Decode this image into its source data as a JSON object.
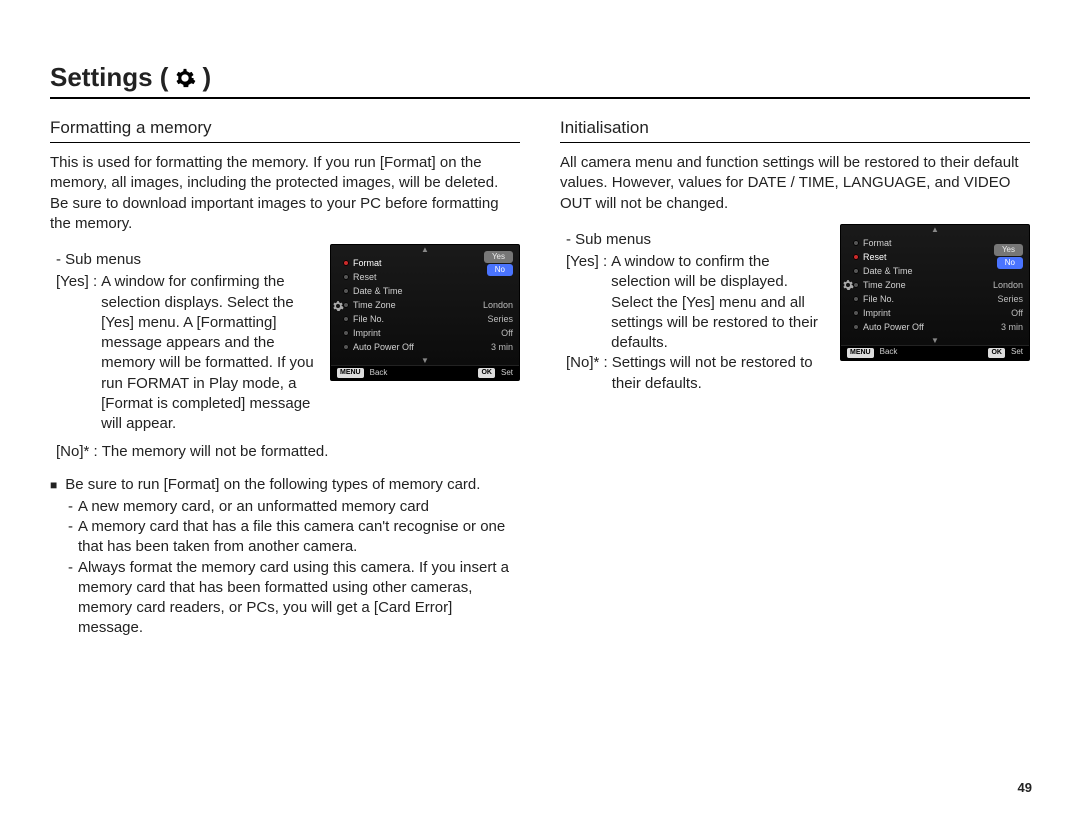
{
  "page": {
    "title_prefix": "Settings (",
    "title_suffix": ")",
    "number": "49"
  },
  "left": {
    "heading": "Formatting a memory",
    "intro": "This is used for formatting the memory. If you run [Format] on the memory, all images, including the protected images, will be deleted. Be sure to download important images to your PC before formatting the memory.",
    "sub_label": "- Sub menus",
    "yes_key": "[Yes] :",
    "yes_val": "A window for confirming the selection displays. Select the [Yes] menu. A [Formatting] message appears and the memory will be formatted. If you run FORMAT in Play mode, a [Format is completed] message will appear.",
    "no_key": "[No]* :",
    "no_val": "The memory will not be formatted.",
    "bullet_lead": "Be sure to run [Format] on the following types of memory card.",
    "dash": [
      "A new memory card, or an unformatted memory card",
      "A memory card that has a file this camera can't recognise or one that has been taken from another camera.",
      "Always format the memory card using this camera. If you insert a memory card that has been formatted using other cameras, memory card readers, or PCs, you will get a [Card Error] message."
    ]
  },
  "right": {
    "heading": "Initialisation",
    "intro": "All camera menu and function settings will be restored to their default values. However, values for DATE / TIME, LANGUAGE, and VIDEO OUT will not be changed.",
    "sub_label": "- Sub menus",
    "yes_key": "[Yes] :",
    "yes_val": "A window to confirm the selection will be displayed. Select the [Yes] menu and all settings will be restored to their defaults.",
    "no_key": "[No]* :",
    "no_val": "Settings will not be restored to their defaults."
  },
  "cam_common": {
    "items": [
      {
        "label": "Format"
      },
      {
        "label": "Reset"
      },
      {
        "label": "Date & Time"
      },
      {
        "label": "Time Zone",
        "value": "London"
      },
      {
        "label": "File No.",
        "value": "Series"
      },
      {
        "label": "Imprint",
        "value": "Off"
      },
      {
        "label": "Auto Power Off",
        "value": "3 min"
      }
    ],
    "opts_yes": "Yes",
    "opts_no": "No",
    "footer_back_tag": "MENU",
    "footer_back": "Back",
    "footer_set_tag": "OK",
    "footer_set": "Set"
  },
  "camA": {
    "current_index": 0
  },
  "camB": {
    "current_index": 1
  }
}
